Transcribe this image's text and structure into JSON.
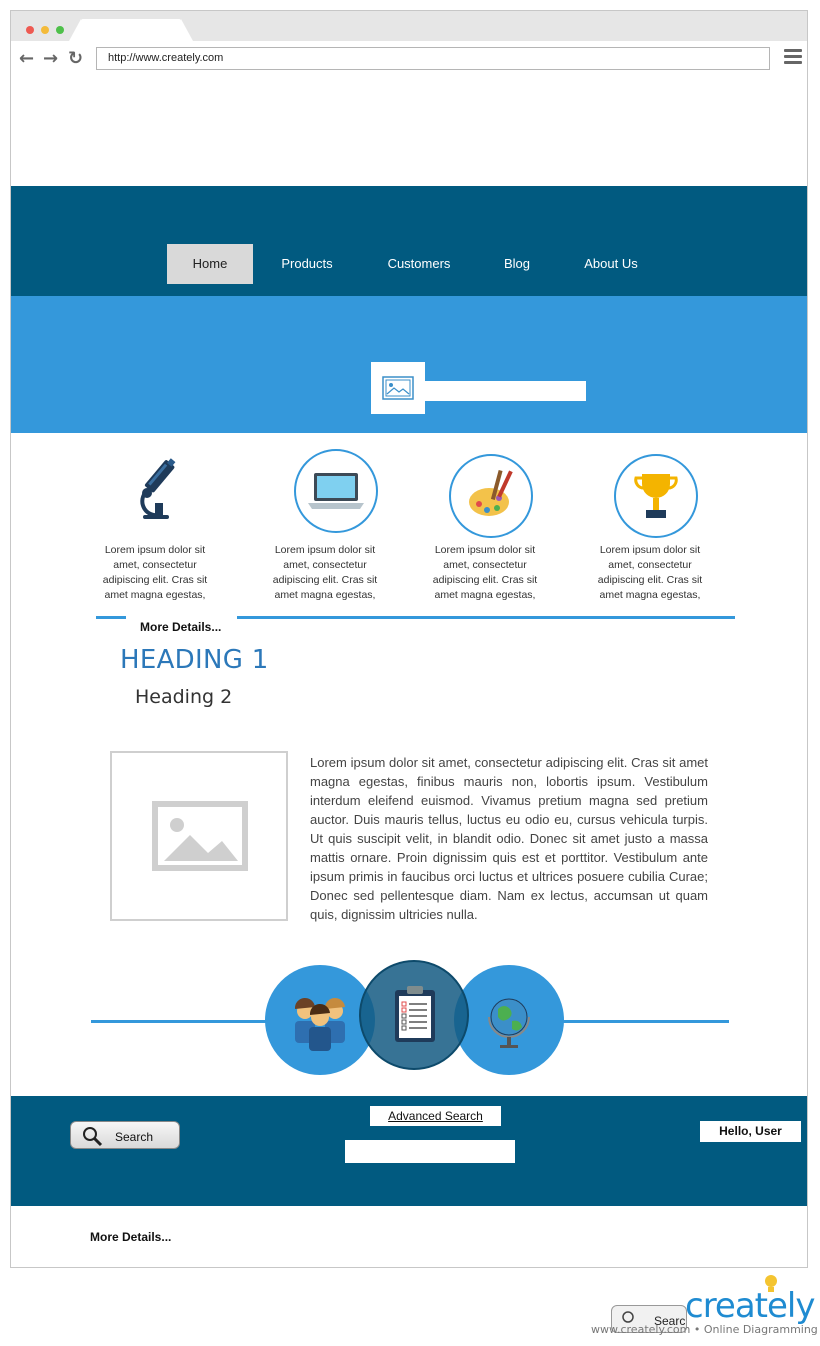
{
  "browser": {
    "url": "http://www.creately.com"
  },
  "nav": {
    "items": [
      {
        "label": "Home"
      },
      {
        "label": "Products"
      },
      {
        "label": "Customers"
      },
      {
        "label": "Blog"
      },
      {
        "label": "About Us"
      }
    ]
  },
  "features": [
    {
      "icon": "microscope-icon",
      "text": "Lorem ipsum dolor sit amet, consectetur adipiscing elit. Cras sit amet magna egestas,"
    },
    {
      "icon": "laptop-icon",
      "text": "Lorem ipsum dolor sit amet, consectetur adipiscing elit. Cras sit amet magna egestas,"
    },
    {
      "icon": "paint-palette-icon",
      "text": "Lorem ipsum dolor sit amet, consectetur adipiscing elit. Cras sit amet magna egestas,"
    },
    {
      "icon": "trophy-icon",
      "text": "Lorem ipsum dolor sit amet, consectetur adipiscing elit. Cras sit amet magna egestas,"
    }
  ],
  "more_details_1": "More Details...",
  "heading1": "HEADING 1",
  "heading2": "Heading 2",
  "content": {
    "paragraph": "Lorem ipsum dolor sit amet, consectetur adipiscing elit. Cras sit amet magna egestas, finibus mauris non, lobortis ipsum. Vestibulum interdum eleifend euismod. Vivamus pretium magna sed pretium auctor. Duis mauris tellus, luctus eu odio eu, cursus vehicula turpis. Ut quis suscipit velit, in blandit odio. Donec sit amet justo a massa mattis ornare. Proin dignissim quis est et porttitor. Vestibulum ante ipsum primis in faucibus orci luctus et ultrices posuere cubilia Curae; Donec sed pellentesque diam. Nam ex lectus, accumsan ut quam quis, dignissim ultricies nulla."
  },
  "circles": [
    {
      "icon": "people-group-icon"
    },
    {
      "icon": "clipboard-checklist-icon"
    },
    {
      "icon": "globe-icon"
    }
  ],
  "footer": {
    "search_label": "Search",
    "advanced_search": "Advanced Search",
    "hello_user": "Hello, User",
    "more_details": "More Details..."
  },
  "watermark": {
    "logo": "creately",
    "tagline": "www.creately.com • Online Diagramming",
    "fragment": "Search"
  },
  "colors": {
    "dark_blue": "#015a80",
    "light_blue": "#3498db",
    "heading_blue": "#2c78b9"
  }
}
